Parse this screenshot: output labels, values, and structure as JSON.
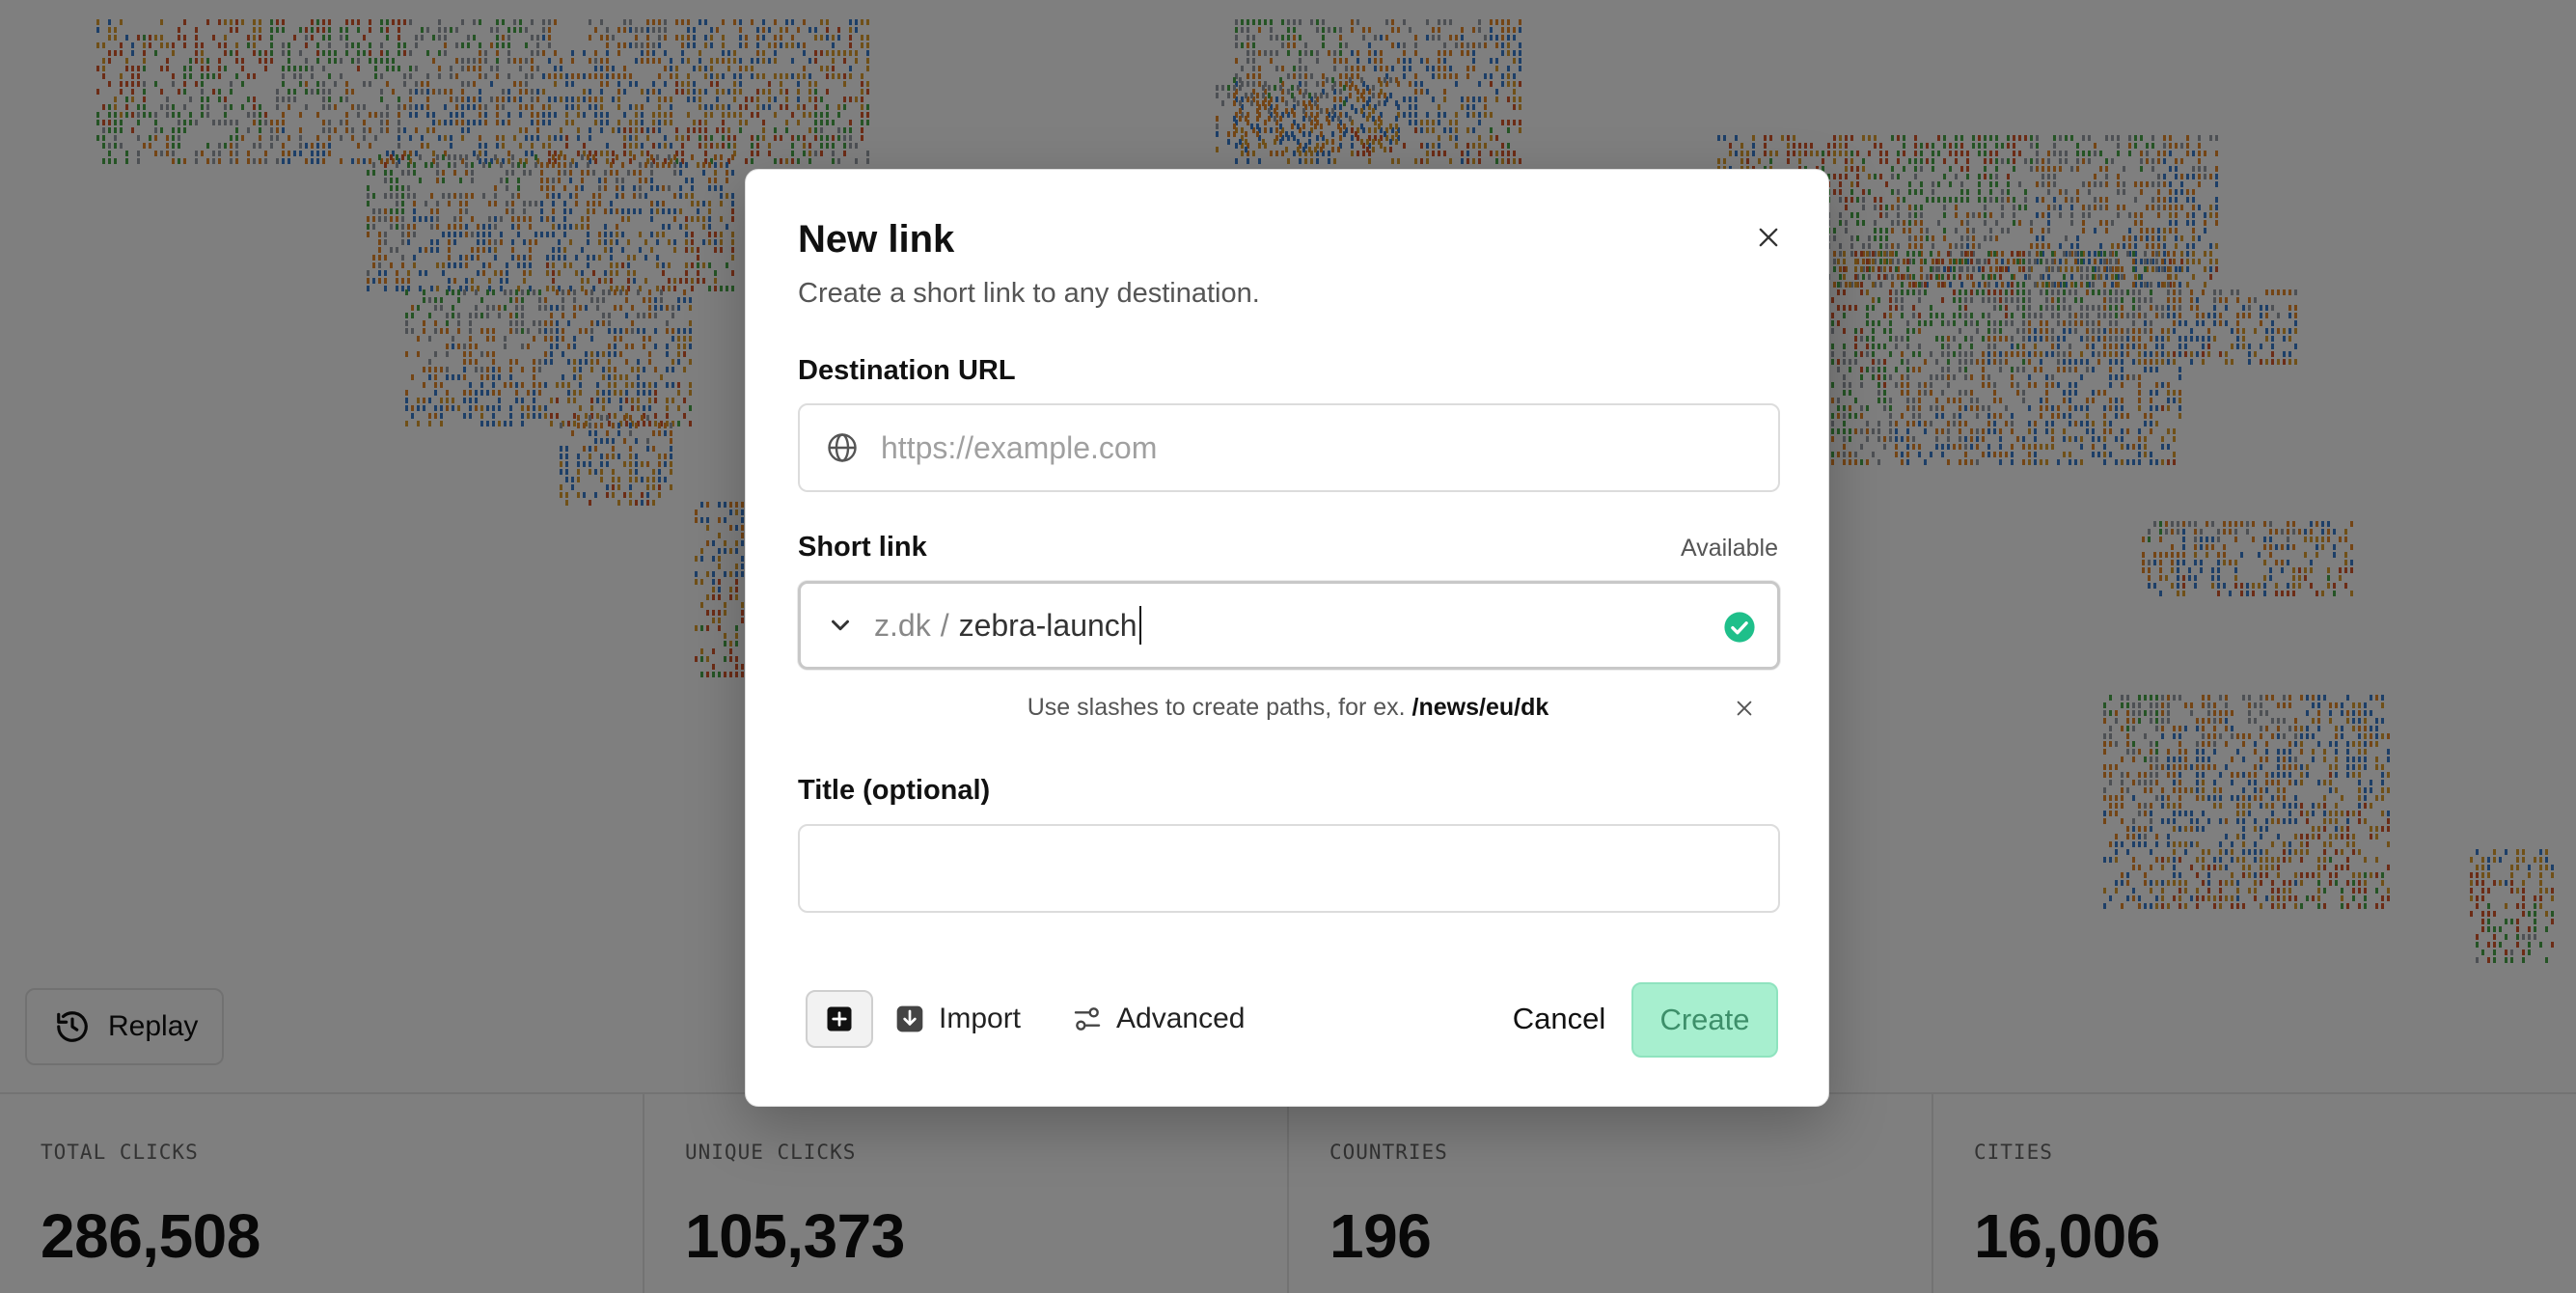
{
  "modal": {
    "title": "New link",
    "subtitle": "Create a short link to any destination.",
    "destination": {
      "label": "Destination URL",
      "placeholder": "https://example.com",
      "value": ""
    },
    "short_link": {
      "label": "Short link",
      "status": "Available",
      "domain": "z.dk",
      "separator": "/",
      "slug": "zebra-launch",
      "hint_text": "Use slashes to create paths, for ex.",
      "hint_example": "/news/eu/dk"
    },
    "title_field": {
      "label": "Title (optional)",
      "value": ""
    },
    "footer": {
      "import_label": "Import",
      "advanced_label": "Advanced",
      "cancel_label": "Cancel",
      "create_label": "Create"
    }
  },
  "background": {
    "replay_label": "Replay",
    "stats": [
      {
        "label": "TOTAL CLICKS",
        "value": "286,508"
      },
      {
        "label": "UNIQUE CLICKS",
        "value": "105,373"
      },
      {
        "label": "COUNTRIES",
        "value": "196"
      },
      {
        "label": "CITIES",
        "value": "16,006"
      }
    ]
  },
  "colors": {
    "create_bg": "#a7efcf",
    "check_green": "#1fbf8a",
    "overlay": "rgba(0,0,0,0.5)"
  }
}
